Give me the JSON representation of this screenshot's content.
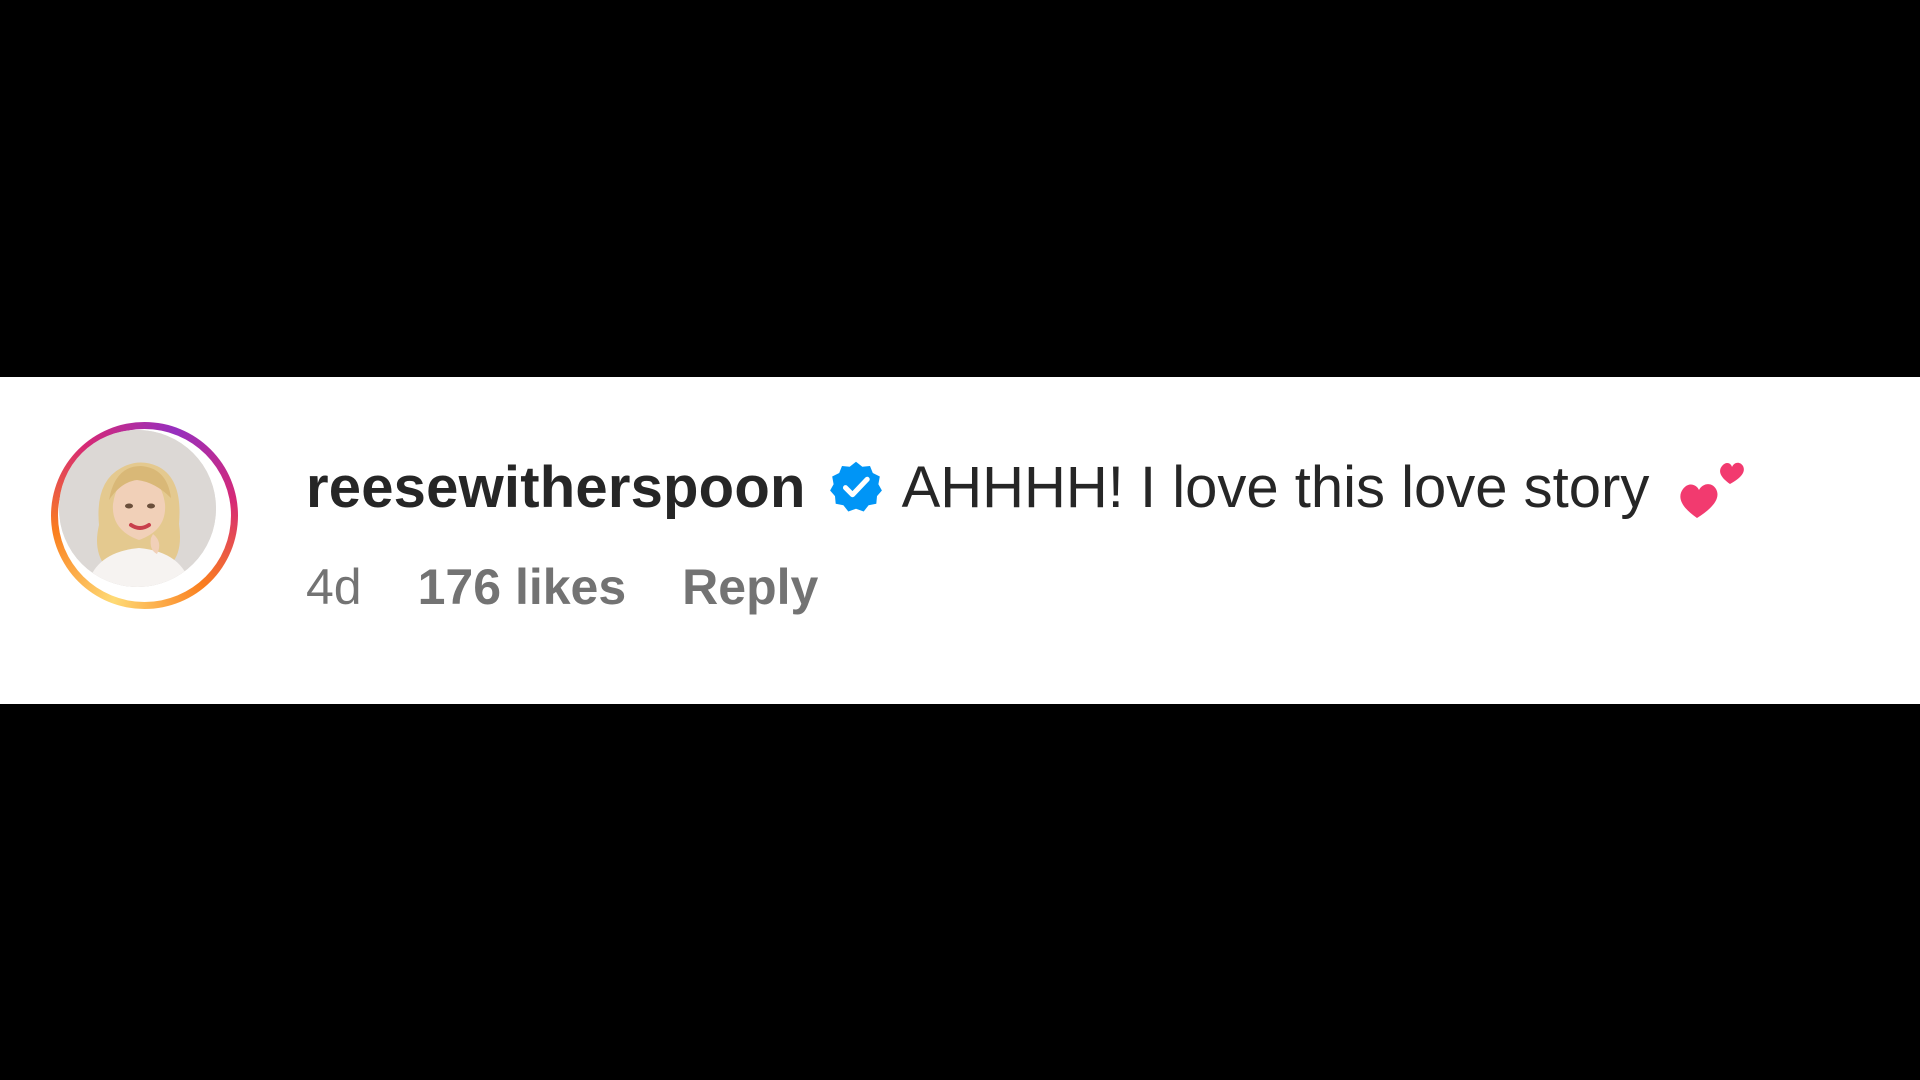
{
  "comment": {
    "username": "reesewitherspoon",
    "verified_icon": "verified-badge-icon",
    "text": "AHHHH! I love this love story",
    "emoji_icon": "two-hearts-emoji-icon",
    "time": "4d",
    "likes": "176 likes",
    "reply_label": "Reply"
  },
  "colors": {
    "background": "#000000",
    "card": "#ffffff",
    "text_primary": "#262626",
    "text_secondary": "#737373",
    "verified_blue": "#0095f6",
    "heart_pink": "#f23a6f"
  }
}
